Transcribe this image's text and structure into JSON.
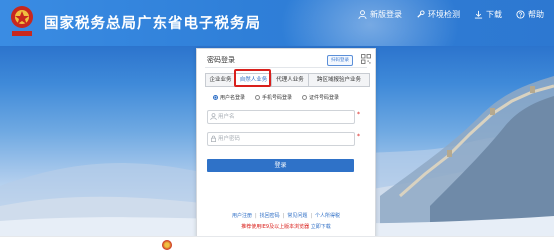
{
  "header": {
    "title": "国家税务总局广东省电子税务局",
    "links": [
      {
        "label": "新版登录",
        "icon": "user-icon"
      },
      {
        "label": "环境检测",
        "icon": "wrench-icon"
      },
      {
        "label": "下载",
        "icon": "download-icon"
      },
      {
        "label": "帮助",
        "icon": "help-icon"
      }
    ]
  },
  "login": {
    "title": "密码登录",
    "badge": "扫码登录",
    "tabs": [
      "企业业务",
      "自然人业务",
      "代理人业务",
      "跨区域报验户业务"
    ],
    "active_tab": 1,
    "login_modes": [
      "用户名登录",
      "手机号码登录",
      "证件号码登录"
    ],
    "selected_mode": 0,
    "username_placeholder": "用户名",
    "password_placeholder": "用户密码",
    "required_mark": "*",
    "submit_label": "登录",
    "links": [
      "用户注册",
      "找回密码",
      "常见问题",
      "个人所得税"
    ],
    "separator": "|",
    "notice_text": "推荐使用IE9及以上版本浏览器",
    "notice_link": "立即下载"
  },
  "colors": {
    "header_blue": "#2f7fd8",
    "button_blue": "#2f72c8",
    "highlight_red": "#d9201c"
  }
}
